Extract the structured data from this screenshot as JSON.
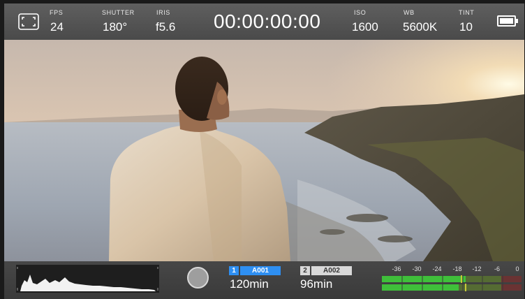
{
  "topbar": {
    "fps": {
      "label": "FPS",
      "value": "24"
    },
    "shutter": {
      "label": "SHUTTER",
      "value": "180°"
    },
    "iris": {
      "label": "IRIS",
      "value": "f5.6"
    },
    "timecode": "00:00:00:00",
    "iso": {
      "label": "ISO",
      "value": "1600"
    },
    "wb": {
      "label": "WB",
      "value": "5600K"
    },
    "tint": {
      "label": "TINT",
      "value": "10"
    },
    "battery_icon": "battery-icon",
    "frame_guide_icon": "frame-guides-icon"
  },
  "bottombar": {
    "record_icon": "record-button",
    "slot1": {
      "number": "1",
      "clip": "A001",
      "remaining": "120min",
      "color": "#2e8ff2"
    },
    "slot2": {
      "number": "2",
      "clip": "A002",
      "remaining": "96min",
      "color": "#d9d9d9"
    },
    "meter_scale": [
      "-36",
      "-30",
      "-24",
      "-18",
      "-12",
      "-6",
      "0"
    ]
  },
  "colors": {
    "accent": "#2e8ff2",
    "meter_green": "#3fbf3a",
    "meter_yellow": "#c8c83a",
    "meter_red": "#b83a3a"
  }
}
